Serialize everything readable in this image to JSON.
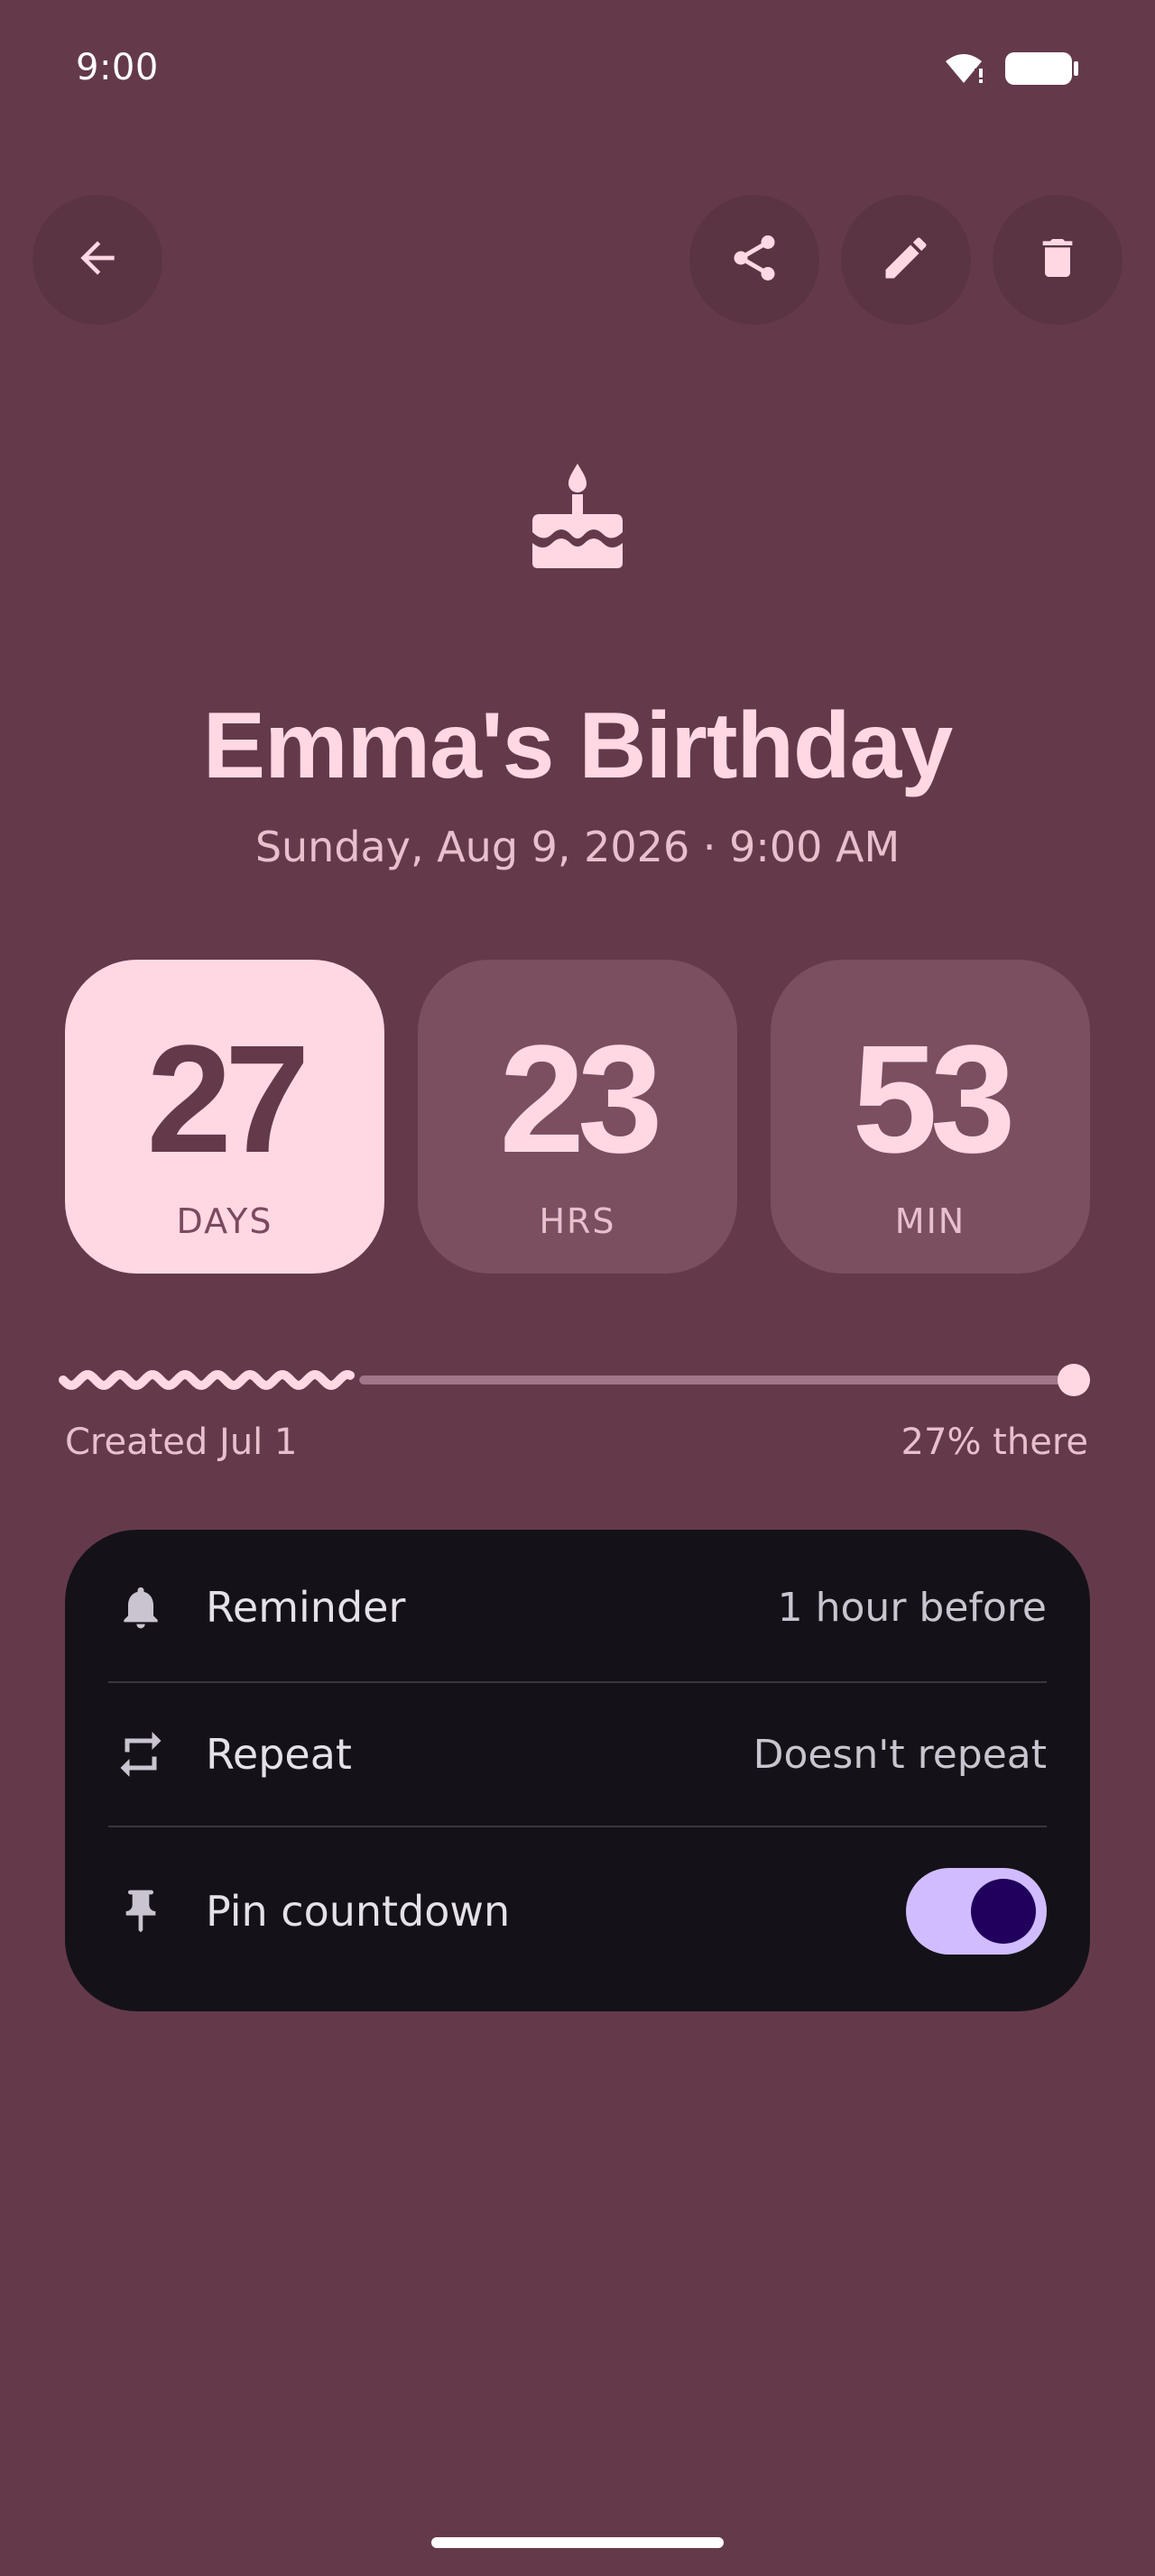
{
  "status_bar": {
    "time": "9:00",
    "icons": [
      "wifi-icon",
      "battery-icon"
    ]
  },
  "toolbar": {
    "back": "arrow-back-icon",
    "share": "share-icon",
    "edit": "edit-icon",
    "delete": "delete-icon"
  },
  "event": {
    "icon": "cake-icon",
    "title": "Emma's Birthday",
    "datetime": "Sunday, Aug 9, 2026 · 9:00 AM"
  },
  "countdown": [
    {
      "value": "27",
      "unit": "DAYS"
    },
    {
      "value": "23",
      "unit": "HRS"
    },
    {
      "value": "53",
      "unit": "MIN"
    }
  ],
  "progress": {
    "created_label": "Created Jul 1",
    "percent_label": "27% there",
    "fraction": 0.27
  },
  "settings": {
    "reminder": {
      "label": "Reminder",
      "value": "1 hour before",
      "icon": "bell-icon"
    },
    "repeat": {
      "label": "Repeat",
      "value": "Doesn't repeat",
      "icon": "repeat-icon"
    },
    "pin": {
      "label": "Pin countdown",
      "enabled": true,
      "icon": "pin-icon"
    }
  },
  "colors": {
    "background": "#643a4b",
    "accent": "#ffd8e4",
    "card": "#141218",
    "toggle_track": "#d0bcff",
    "toggle_knob": "#21005d"
  }
}
